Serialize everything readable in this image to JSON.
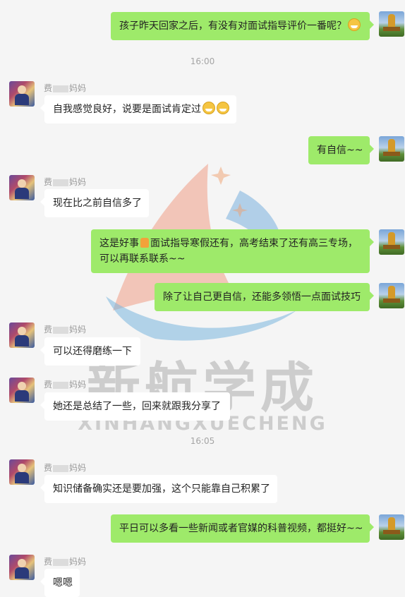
{
  "watermark": {
    "cn": "新航学成",
    "en": "XINHANGXUECHENG"
  },
  "timestamps": [
    "16:00",
    "16:05"
  ],
  "parent_name": {
    "prefix": "费",
    "suffix": "妈妈"
  },
  "messages": [
    {
      "from": "self",
      "text": "孩子昨天回家之后，有没有对面试指导评价一番呢？"
    },
    {
      "from": "parent",
      "text": "自我感觉良好，说要是面试肯定过"
    },
    {
      "from": "self",
      "text": "有自信~~"
    },
    {
      "from": "parent",
      "text": "现在比之前自信多了"
    },
    {
      "from": "self",
      "text_a": "这是好事",
      "text_b": "面试指导寒假还有，高考结束了还有高三专场，可以再联系联系~~"
    },
    {
      "from": "self",
      "text": "除了让自己更自信，还能多领悟一点面试技巧"
    },
    {
      "from": "parent",
      "text": "可以还得磨练一下"
    },
    {
      "from": "parent",
      "text": "她还是总结了一些，回来就跟我分享了"
    },
    {
      "from": "parent",
      "text": "知识储备确实还是要加强，这个只能靠自己积累了"
    },
    {
      "from": "self",
      "text": "平日可以多看一些新闻或者官媒的科普视频，都挺好~~"
    },
    {
      "from": "parent",
      "text": "嗯嗯"
    }
  ],
  "emoji_names": [
    "grinning-emoji",
    "thumbs-up-emoji"
  ]
}
